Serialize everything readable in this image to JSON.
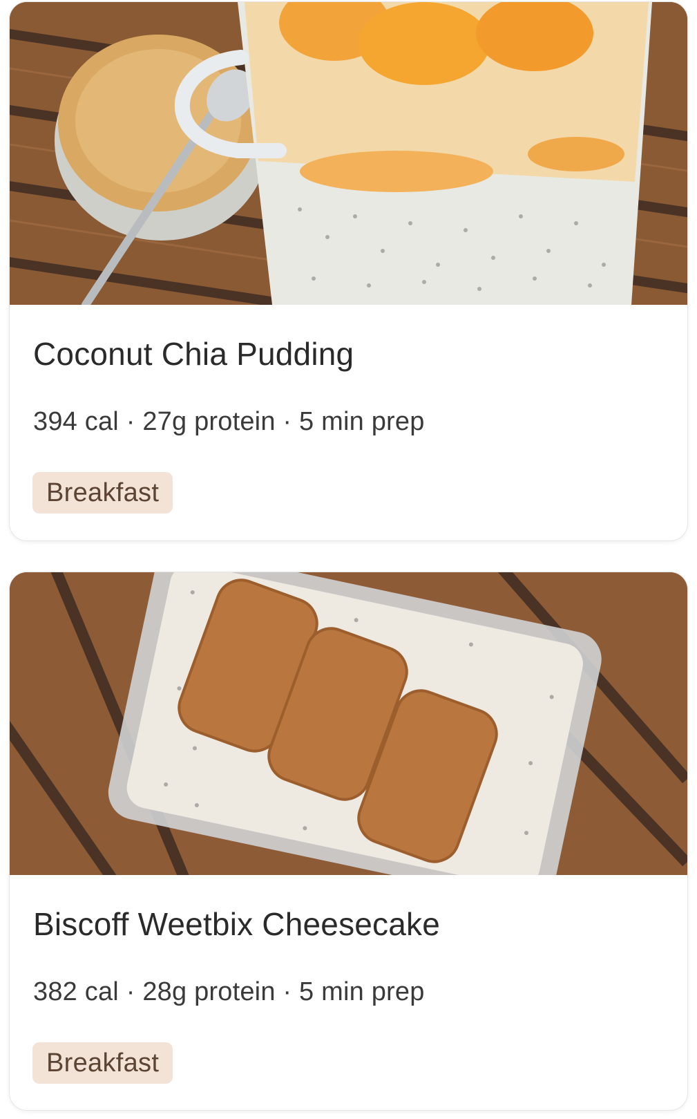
{
  "recipes": [
    {
      "title": "Coconut Chia Pudding",
      "calories": "394 cal",
      "protein": "27g protein",
      "prep": "5 min prep",
      "separator": " · ",
      "tag": "Breakfast"
    },
    {
      "title": "Biscoff Weetbix Cheesecake",
      "calories": "382 cal",
      "protein": "28g protein",
      "prep": "5 min prep",
      "separator": " · ",
      "tag": "Breakfast"
    }
  ],
  "colors": {
    "tag_background": "#f3e3d7",
    "tag_text": "#5b4433",
    "title_text": "#2a2a2a",
    "card_border": "#e6e6e6"
  }
}
